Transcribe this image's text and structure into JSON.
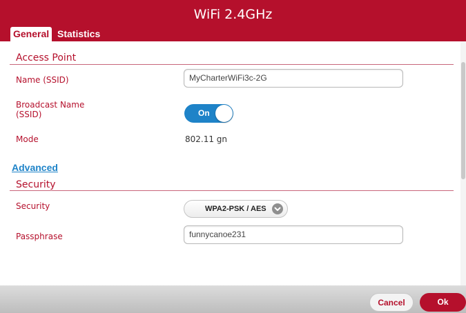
{
  "dialog": {
    "title": "WiFi 2.4GHz"
  },
  "tabs": [
    {
      "label": "General",
      "active": true
    },
    {
      "label": "Statistics",
      "active": false
    }
  ],
  "access_point": {
    "section_title": "Access Point",
    "name_label": "Name (SSID)",
    "name_value": "MyCharterWiFi3c-2G",
    "broadcast_label": "Broadcast Name\n(SSID)",
    "broadcast_toggle": "On",
    "broadcast_on": true,
    "mode_label": "Mode",
    "mode_value": "802.11 gn"
  },
  "advanced_link": "Advanced",
  "security": {
    "section_title": "Security",
    "security_label": "Security",
    "security_value": "WPA2-PSK / AES",
    "passphrase_label": "Passphrase",
    "passphrase_value": "funnycanoe231"
  },
  "footer": {
    "cancel_label": "Cancel",
    "ok_label": "Ok"
  },
  "colors": {
    "brand": "#b5102c",
    "accent": "#1e83c8"
  }
}
